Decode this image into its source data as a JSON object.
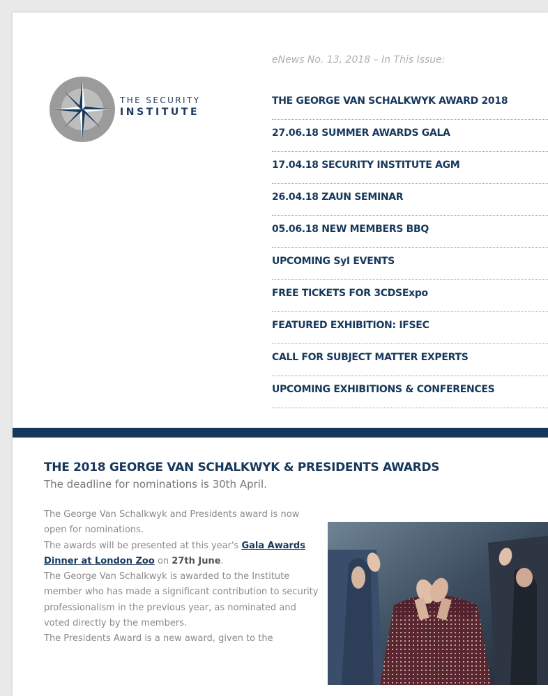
{
  "brand": {
    "line1": "THE SECURITY",
    "line2": "INSTITUTE",
    "colors": {
      "navy": "#14375d",
      "gray": "#8c8c8c"
    }
  },
  "issue": {
    "title": "eNews No. 13, 2018 – In This Issue:"
  },
  "toc": [
    "THE GEORGE VAN SCHALKWYK AWARD 2018",
    "27.06.18 SUMMER AWARDS GALA",
    "17.04.18 SECURITY INSTITUTE AGM",
    "26.04.18 ZAUN SEMINAR",
    "05.06.18 NEW MEMBERS BBQ",
    "UPCOMING SyI EVENTS",
    "FREE TICKETS FOR 3CDSExpo",
    "FEATURED EXHIBITION: IFSEC",
    "CALL FOR SUBJECT MATTER EXPERTS",
    "UPCOMING EXHIBITIONS & CONFERENCES"
  ],
  "article": {
    "title": "THE 2018 GEORGE VAN SCHALKWYK & PRESIDENTS AWARDS",
    "subtitle": "The deadline for nominations is 30th April.",
    "p1": "The George Van Schalkwyk and Presidents award is now open for nominations.",
    "p2_before": "The awards will be presented at this year's ",
    "p2_link": "Gala Awards Dinner at London Zoo",
    "p2_mid": " on ",
    "p2_date": "27th June",
    "p2_after": ".",
    "p3": "The George Van Schalkwyk is awarded to the Institute member who has made a significant contribution to security professionalism in the previous year, as nominated and voted directly by the members.",
    "p4": "The Presidents Award is a new award, given to the"
  },
  "icons": {
    "logo": "compass-star-icon",
    "photo": "applauding-audience-photo"
  }
}
